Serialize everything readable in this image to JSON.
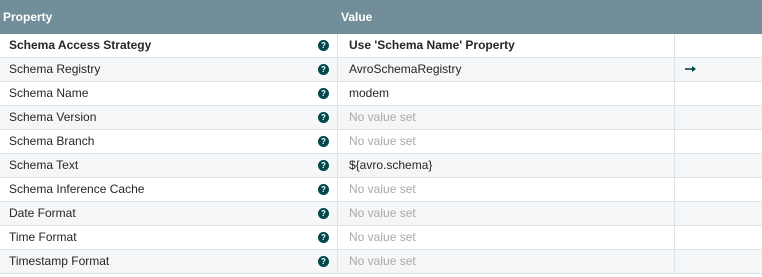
{
  "header": {
    "property_label": "Property",
    "value_label": "Value"
  },
  "rows": [
    {
      "name": "Schema Access Strategy",
      "value": "Use 'Schema Name' Property",
      "bold": true,
      "empty": false,
      "has_arrow": false
    },
    {
      "name": "Schema Registry",
      "value": "AvroSchemaRegistry",
      "bold": false,
      "empty": false,
      "has_arrow": true
    },
    {
      "name": "Schema Name",
      "value": "modem",
      "bold": false,
      "empty": false,
      "has_arrow": false
    },
    {
      "name": "Schema Version",
      "value": "No value set",
      "bold": false,
      "empty": true,
      "has_arrow": false
    },
    {
      "name": "Schema Branch",
      "value": "No value set",
      "bold": false,
      "empty": true,
      "has_arrow": false
    },
    {
      "name": "Schema Text",
      "value": "${avro.schema}",
      "bold": false,
      "empty": false,
      "has_arrow": false
    },
    {
      "name": "Schema Inference Cache",
      "value": "No value set",
      "bold": false,
      "empty": true,
      "has_arrow": false
    },
    {
      "name": "Date Format",
      "value": "No value set",
      "bold": false,
      "empty": true,
      "has_arrow": false
    },
    {
      "name": "Time Format",
      "value": "No value set",
      "bold": false,
      "empty": true,
      "has_arrow": false
    },
    {
      "name": "Timestamp Format",
      "value": "No value set",
      "bold": false,
      "empty": true,
      "has_arrow": false
    }
  ],
  "icons": {
    "help": "help-circle-icon",
    "goto": "arrow-right-icon"
  },
  "colors": {
    "header_bg": "#728e9b",
    "help_icon": "#004849",
    "empty_text": "#a8a8a8"
  }
}
